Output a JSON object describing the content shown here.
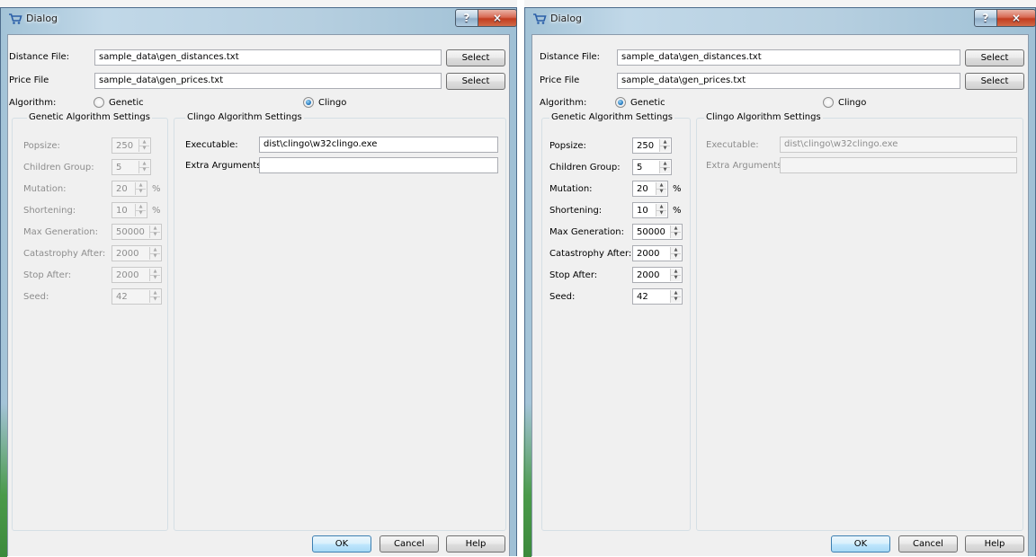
{
  "dialogs": [
    {
      "title": "Dialog",
      "distance_label": "Distance File:",
      "distance_value": "sample_data\\gen_distances.txt",
      "price_label": "Price File",
      "price_value": "sample_data\\gen_prices.txt",
      "select_label": "Select",
      "algorithm_label": "Algorithm:",
      "genetic_label": "Genetic",
      "clingo_label": "Clingo",
      "selected_algorithm": "Clingo",
      "genetic_group_title": "Genetic Algorithm Settings",
      "clingo_group_title": "Clingo Algorithm Settings",
      "params": [
        {
          "label": "Popsize:",
          "value": "250",
          "suffix": ""
        },
        {
          "label": "Children Group:",
          "value": "5",
          "suffix": ""
        },
        {
          "label": "Mutation:",
          "value": "20",
          "suffix": "%"
        },
        {
          "label": "Shortening:",
          "value": "10",
          "suffix": "%"
        },
        {
          "label": "Max Generation:",
          "value": "50000",
          "suffix": ""
        },
        {
          "label": "Catastrophy After:",
          "value": "2000",
          "suffix": ""
        },
        {
          "label": "Stop After:",
          "value": "2000",
          "suffix": ""
        },
        {
          "label": "Seed:",
          "value": "42",
          "suffix": ""
        }
      ],
      "executable_label": "Executable:",
      "executable_value": "dist\\clingo\\w32clingo.exe",
      "extra_args_label": "Extra Arguments:",
      "extra_args_value": "",
      "ok_label": "OK",
      "cancel_label": "Cancel",
      "help_label": "Help",
      "help_title_btn": "?",
      "close_title_btn": "×"
    },
    {
      "title": "Dialog",
      "distance_label": "Distance File:",
      "distance_value": "sample_data\\gen_distances.txt",
      "price_label": "Price File",
      "price_value": "sample_data\\gen_prices.txt",
      "select_label": "Select",
      "algorithm_label": "Algorithm:",
      "genetic_label": "Genetic",
      "clingo_label": "Clingo",
      "selected_algorithm": "Genetic",
      "genetic_group_title": "Genetic Algorithm Settings",
      "clingo_group_title": "Clingo Algorithm Settings",
      "params": [
        {
          "label": "Popsize:",
          "value": "250",
          "suffix": ""
        },
        {
          "label": "Children Group:",
          "value": "5",
          "suffix": ""
        },
        {
          "label": "Mutation:",
          "value": "20",
          "suffix": "%"
        },
        {
          "label": "Shortening:",
          "value": "10",
          "suffix": "%"
        },
        {
          "label": "Max Generation:",
          "value": "50000",
          "suffix": ""
        },
        {
          "label": "Catastrophy After:",
          "value": "2000",
          "suffix": ""
        },
        {
          "label": "Stop After:",
          "value": "2000",
          "suffix": ""
        },
        {
          "label": "Seed:",
          "value": "42",
          "suffix": ""
        }
      ],
      "executable_label": "Executable:",
      "executable_value": "dist\\clingo\\w32clingo.exe",
      "extra_args_label": "Extra Arguments:",
      "extra_args_value": "",
      "ok_label": "OK",
      "cancel_label": "Cancel",
      "help_label": "Help",
      "help_title_btn": "?",
      "close_title_btn": "×"
    }
  ],
  "colors": {
    "title_gradient": "#c1d8e8",
    "radio_selected": "#1a6fb8",
    "disabled_text": "#8d8d8d",
    "default_button_border": "#3c7fb1"
  }
}
